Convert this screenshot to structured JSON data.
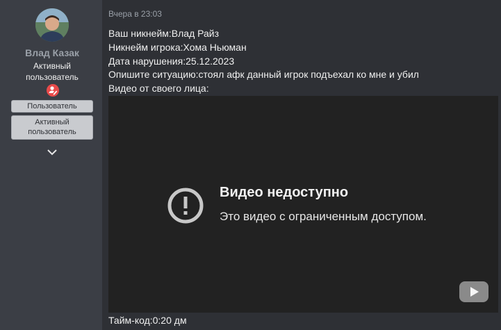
{
  "sidebar": {
    "username": "Влад Казак",
    "user_title_line1": "Активный",
    "user_title_line2": "пользователь",
    "banners": [
      "Пользователь",
      "Активный",
      "пользователь"
    ],
    "badge_icon": "user-badge-icon",
    "expand_icon": "chevron-down-icon"
  },
  "post": {
    "date": "Вчера в 23:03",
    "lines": [
      "Ваш никнейм:Влад Райз",
      "Никнейм игрока:Хома Ньюман",
      "Дата нарушения:25.12.2023",
      "Опишите ситуацию:стоял афк данный игрок подъехал ко мне и убил",
      "Видео от своего лица:"
    ],
    "video": {
      "title": "Видео недоступно",
      "subtitle": "Это видео с ограниченным доступом.",
      "icon": "exclamation-circle-icon",
      "logo": "youtube-logo-icon"
    },
    "timecode": "Тайм-код:0:20 дм"
  },
  "colors": {
    "background": "#2e3035",
    "sidebar": "#3b3e45",
    "player": "#222222",
    "badge": "#e94a4a"
  }
}
